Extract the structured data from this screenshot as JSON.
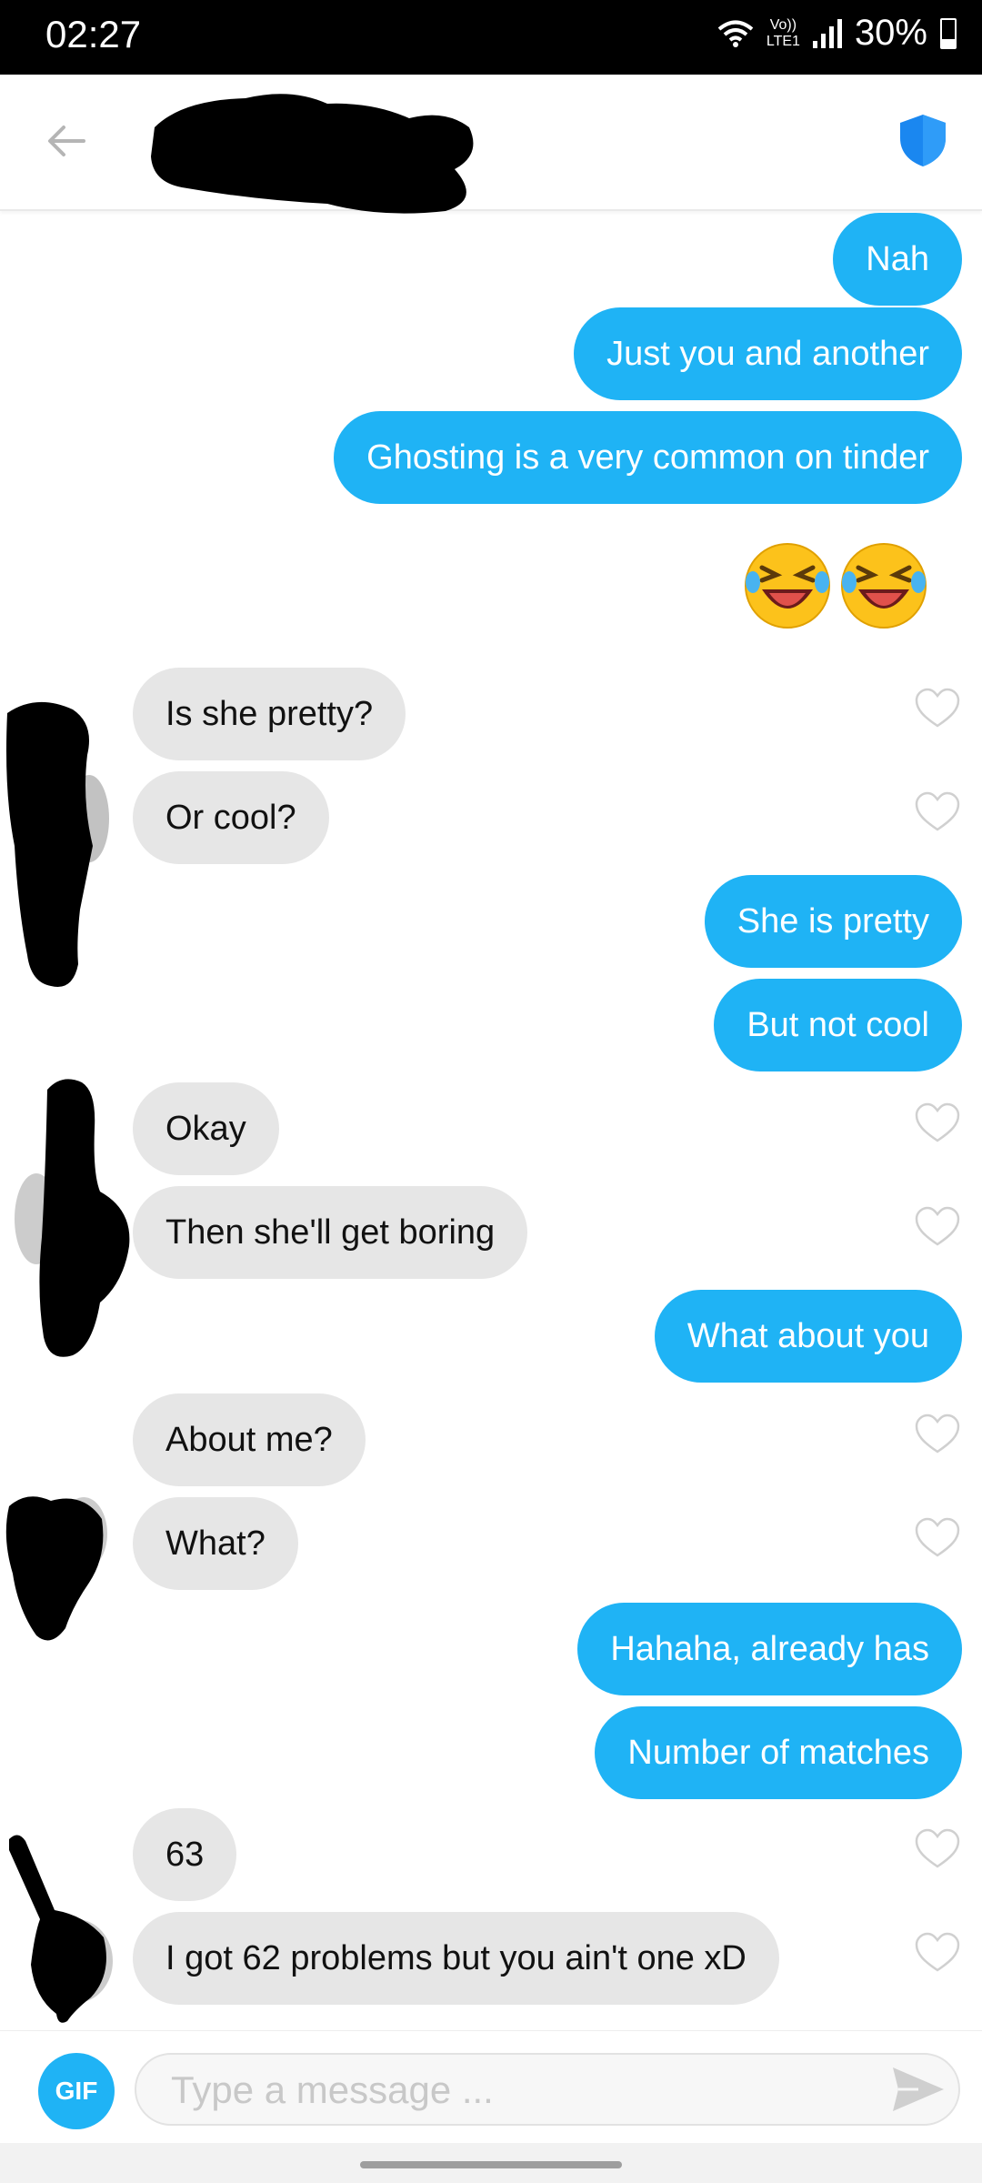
{
  "status_bar": {
    "time": "02:27",
    "network_top": "Vo))",
    "network_bottom": "LTE1",
    "battery": "30%"
  },
  "header": {
    "back_icon": "arrow-left-icon",
    "safety_icon": "shield-icon",
    "accent_color": "#1fb3f5"
  },
  "messages": [
    {
      "side": "out",
      "text": "Nah"
    },
    {
      "side": "out",
      "text": "Just you and another"
    },
    {
      "side": "out",
      "text": "Ghosting is a very common on tinder"
    },
    {
      "side": "out",
      "emoji": "rolling-on-floor-laughing x2"
    },
    {
      "side": "in",
      "text": "Is she pretty?"
    },
    {
      "side": "in",
      "text": "Or cool?"
    },
    {
      "side": "out",
      "text": "She is pretty"
    },
    {
      "side": "out",
      "text": "But not cool"
    },
    {
      "side": "in",
      "text": "Okay"
    },
    {
      "side": "in",
      "text": "Then she'll get boring"
    },
    {
      "side": "out",
      "text": "What about you"
    },
    {
      "side": "in",
      "text": "About me?"
    },
    {
      "side": "in",
      "text": "What?"
    },
    {
      "side": "out",
      "text": "Hahaha, already has"
    },
    {
      "side": "out",
      "text": "Number of matches"
    },
    {
      "side": "in",
      "text": "63"
    },
    {
      "side": "in",
      "text": "I got 62 problems but you ain't one xD"
    }
  ],
  "composer": {
    "gif_label": "GIF",
    "placeholder": "Type a message ...",
    "send_icon": "send-icon"
  }
}
